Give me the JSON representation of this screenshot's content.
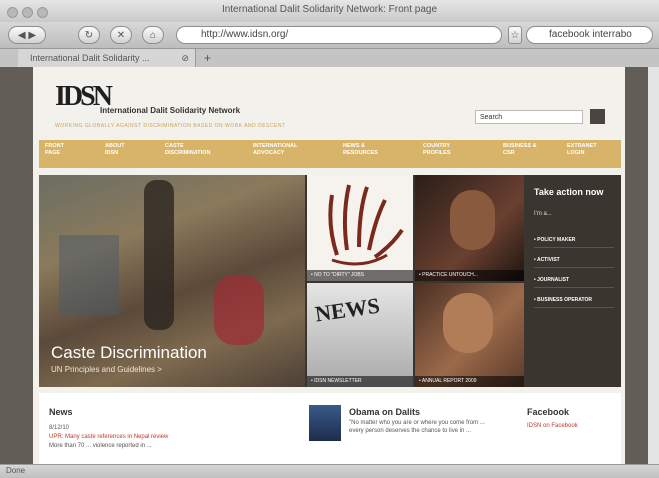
{
  "window": {
    "title": "International Dalit Solidarity Network: Front page"
  },
  "toolbar": {
    "back": "◀",
    "forward": "▶",
    "url": "http://www.idsn.org/",
    "search_value": "facebook interrabo"
  },
  "tabs": [
    {
      "label": "International Dalit Solidarity ..."
    }
  ],
  "tab_add": "+",
  "site": {
    "logo": "IDSN",
    "name": "International Dalit Solidarity Network",
    "tagline": "WORKING GLOBALLY AGAINST DISCRIMINATION BASED ON WORK AND DESCENT",
    "search_placeholder": "Search",
    "nav": [
      {
        "label": "FRONT PAGE"
      },
      {
        "label": "ABOUT IDSN"
      },
      {
        "label": "CASTE DISCRIMINATION"
      },
      {
        "label": "INTERNATIONAL ADVOCACY"
      },
      {
        "label": "NEWS & RESOURCES"
      },
      {
        "label": "COUNTRY PROFILES"
      },
      {
        "label": "BUSINESS & CSR"
      },
      {
        "label": "EXTRANET LOGIN"
      }
    ],
    "hero": {
      "title": "Caste Discrimination",
      "subtitle": "UN Principles and Guidelines >"
    },
    "tiles": [
      {
        "caption": "• NO TO \"DIRTY\" JOBS"
      },
      {
        "caption": "• PRACTICE UNTOUCH..."
      },
      {
        "caption": "• IDSN NEWSLETTER"
      },
      {
        "caption": "• ANNUAL REPORT 2009"
      }
    ],
    "take_action": {
      "title": "Take action now",
      "sub": "I'm a...",
      "items": [
        "• POLICY MAKER",
        "• ACTIVIST",
        "• JOURNALIST",
        "• BUSINESS OPERATOR"
      ]
    },
    "news": {
      "title": "News",
      "date": "8/12/10",
      "item1": "UPR: Many caste references in Nepal review",
      "item2": "More than 70 ... violence reported in ..."
    },
    "obama": {
      "title": "Obama on Dalits",
      "text": "\"No matter who you are or where you come from ... every person deserves the chance to live in ..."
    },
    "facebook": {
      "title": "Facebook",
      "link": "IDSN on Facebook"
    }
  },
  "status": {
    "text": "Done"
  },
  "colors": {
    "nav": "#d8b46a",
    "dark": "#3a352f",
    "accent": "#c0392b"
  }
}
